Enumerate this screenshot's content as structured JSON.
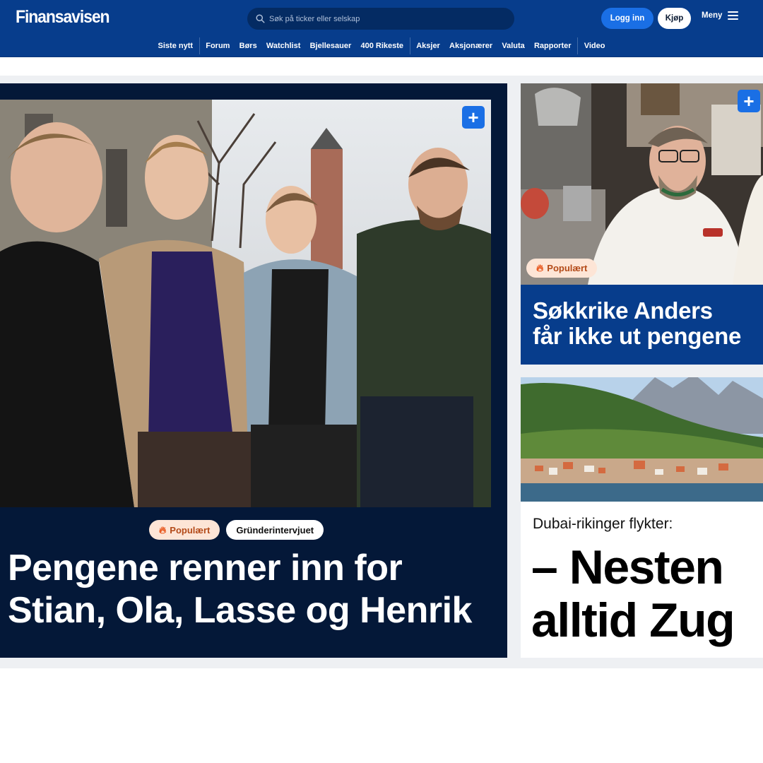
{
  "header": {
    "logo": "Finansavisen",
    "search_placeholder": "Søk på ticker eller selskap",
    "login_label": "Logg inn",
    "buy_label": "Kjøp",
    "menu_label": "Meny"
  },
  "nav": {
    "items": [
      "Siste nytt",
      "Forum",
      "Børs",
      "Watchlist",
      "Bjellesauer",
      "400 Rikeste",
      "Aksjer",
      "Aksjonærer",
      "Valuta",
      "Rapporter",
      "Video"
    ]
  },
  "main_article": {
    "tag_popular": "Populært",
    "tag_section": "Gründerintervjuet",
    "headline_line1": "Pengene renner inn for",
    "headline_line2": "Stian, Ola, Lasse og Henrik"
  },
  "article2": {
    "tag_popular": "Populært",
    "headline_line1": "Søkkrike Anders",
    "headline_line2": "får ikke ut pengene"
  },
  "article3": {
    "kicker": "Dubai-rikinger flykter:",
    "headline_line1": "– Nesten",
    "headline_line2": "alltid Zug"
  },
  "colors": {
    "header_bg": "#073d8c",
    "accent_blue": "#1a6fe5",
    "main_card_bg": "#041838",
    "popular_tag_bg": "#fde5d6",
    "popular_tag_text": "#b34a18"
  },
  "icons": [
    "search-icon",
    "menu-icon",
    "plus-icon",
    "flame-icon"
  ]
}
